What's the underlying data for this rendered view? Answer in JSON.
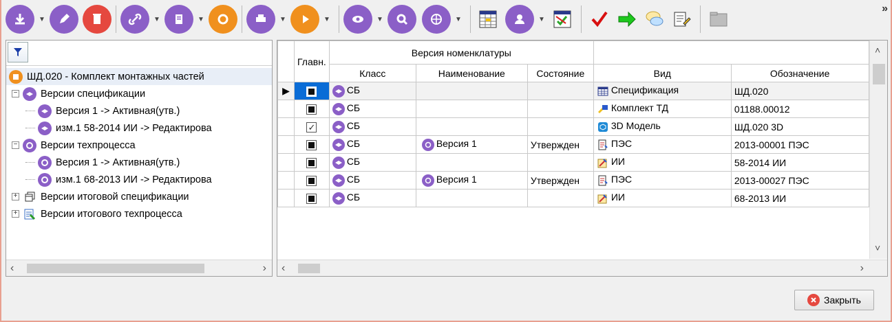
{
  "toolbar": {
    "icons": [
      "download-icon",
      "pencil-icon",
      "trash-icon",
      "link-icon",
      "clipboard-icon",
      "refresh-icon",
      "printer-icon",
      "play-icon",
      "eye-icon",
      "magnifier-icon",
      "globe-icon",
      "spreadsheet-icon",
      "user-icon",
      "checklist-icon",
      "checkmark-icon",
      "arrow-right-icon",
      "chat-bubble-icon",
      "document-edit-icon",
      "folder-icon"
    ],
    "more": "»"
  },
  "tree": {
    "root": "ШД.020 - Комплект монтажных частей",
    "spec_group": "Версии спецификации",
    "spec_items": [
      "Версия 1 -> Активная(утв.)",
      "изм.1 58-2014 ИИ -> Редактирова"
    ],
    "tech_group": "Версии техпроцесса",
    "tech_items": [
      "Версия 1 -> Активная(утв.)",
      "изм.1 68-2013 ИИ -> Редактирова"
    ],
    "total_spec": "Версии итоговой спецификации",
    "total_tech": "Версии итогового техпроцесса"
  },
  "grid": {
    "header_main": "Главн.",
    "header_group": "Версия номенклатуры",
    "columns": [
      "Класс",
      "Наименование",
      "Состояние",
      "Вид",
      "Обозначение"
    ],
    "rows": [
      {
        "main": "filled",
        "cls": "СБ",
        "name": "",
        "state": "",
        "kind": "Спецификация",
        "kind_icon": "spec-table-icon",
        "code": "ШД.020"
      },
      {
        "main": "filled",
        "cls": "СБ",
        "name": "",
        "state": "",
        "kind": "Комплект ТД",
        "kind_icon": "tech-kit-icon",
        "code": "01188.00012"
      },
      {
        "main": "tick",
        "cls": "СБ",
        "name": "",
        "state": "",
        "kind": "3D Модель",
        "kind_icon": "cube-3d-icon",
        "code": "ШД.020 3D"
      },
      {
        "main": "filled",
        "cls": "СБ",
        "name": "Версия 1",
        "state": "Утвержден",
        "kind": "ПЭС",
        "kind_icon": "doc-pes-icon",
        "code": "2013-00001 ПЭС"
      },
      {
        "main": "filled",
        "cls": "СБ",
        "name": "",
        "state": "",
        "kind": "ИИ",
        "kind_icon": "doc-ii-icon",
        "code": "58-2014 ИИ"
      },
      {
        "main": "filled",
        "cls": "СБ",
        "name": "Версия 1",
        "state": "Утвержден",
        "kind": "ПЭС",
        "kind_icon": "doc-pes-icon",
        "code": "2013-00027 ПЭС"
      },
      {
        "main": "filled",
        "cls": "СБ",
        "name": "",
        "state": "",
        "kind": "ИИ",
        "kind_icon": "doc-ii-icon",
        "code": "68-2013 ИИ"
      }
    ]
  },
  "close_button": "Закрыть"
}
